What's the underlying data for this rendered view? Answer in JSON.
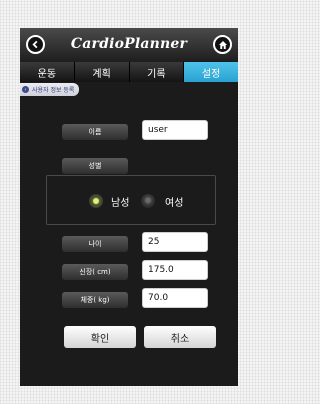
{
  "header": {
    "logo_text": "CardioPlanner"
  },
  "tabs": [
    {
      "label": "운동"
    },
    {
      "label": "계획"
    },
    {
      "label": "기록"
    },
    {
      "label": "설정"
    }
  ],
  "breadcrumb": {
    "label": "사용자 정보 등록"
  },
  "form": {
    "name_label": "이름",
    "name_value": "user",
    "gender_label": "성별",
    "gender_options": [
      {
        "label": "남성",
        "selected": true
      },
      {
        "label": "여성",
        "selected": false
      }
    ],
    "age_label": "나이",
    "age_value": "25",
    "height_label": "신장( cm)",
    "height_value": "175.0",
    "weight_label": "체중( kg)",
    "weight_value": "70.0"
  },
  "buttons": {
    "confirm": "확인",
    "cancel": "취소"
  },
  "colors": {
    "active_tab": "#3cb4e0",
    "background": "#1b1b1b",
    "radio_selected": "#d9f27a"
  }
}
